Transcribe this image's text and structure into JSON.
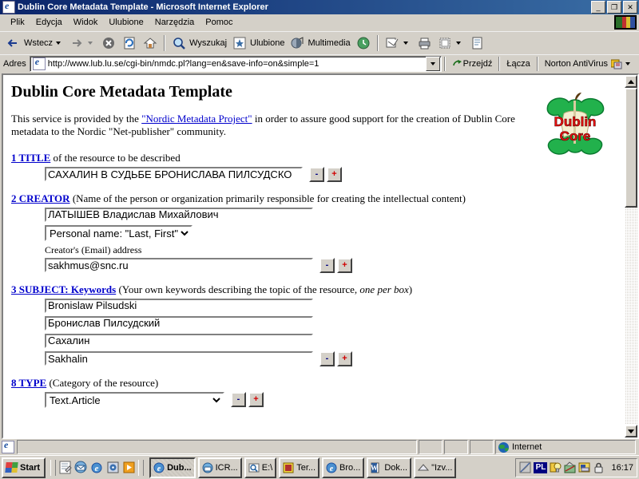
{
  "window": {
    "title": "Dublin Core Metadata Template - Microsoft Internet Explorer",
    "minimize": "_",
    "restore": "❐",
    "close": "✕"
  },
  "menu": [
    "Plik",
    "Edycja",
    "Widok",
    "Ulubione",
    "Narzędzia",
    "Pomoc"
  ],
  "toolbar": {
    "back": "Wstecz",
    "search": "Wyszukaj",
    "favorites": "Ulubione",
    "media": "Multimedia"
  },
  "address": {
    "label": "Adres",
    "url": "http://www.lub.lu.se/cgi-bin/nmdc.pl?lang=en&save-info=on&simple=1",
    "go": "Przejdź",
    "links": "Łącza",
    "antivirus": "Norton AntiVirus"
  },
  "page": {
    "title": "Dublin Core Metadata Template",
    "intro_before": "This service is provided by the ",
    "intro_link": "\"Nordic Metadata Project\"",
    "intro_after": " in order to assure good support for the creation of Dublin Core metadata to the Nordic \"Net-publisher\" community.",
    "logo_line1": "Dublin",
    "logo_line2": "Core",
    "minus": "-",
    "plus": "+",
    "sections": [
      {
        "number_label": "1 TITLE",
        "description": " of the resource to be described",
        "values": [
          "САХАЛИН В СУДЬБЕ БРОНИСЛАВА ПИЛСУДСКО"
        ]
      },
      {
        "number_label": "2 CREATOR",
        "description": " (Name of the person or organization primarily responsible for creating the intellectual content)",
        "values": [
          "ЛАТЫШЕВ Владислав Михайлович"
        ],
        "select_value": "Personal name: \"Last, First\"",
        "sublabel": "Creator's (Email) address",
        "email": "sakhmus@snc.ru"
      },
      {
        "number_label": "3 SUBJECT: Keywords",
        "description_plain": " (Your own keywords describing the topic of the resource, ",
        "description_italic": "one per box",
        "description_tail": ")",
        "values": [
          "Bronislaw Pilsudski",
          "Бронислав Пилсудский",
          "Сахалин",
          "Sakhalin"
        ]
      },
      {
        "number_label": "8 TYPE",
        "description": " (Category of the resource)",
        "select_value": "Text.Article"
      }
    ]
  },
  "status": {
    "message": "",
    "zone": "Internet"
  },
  "taskbar": {
    "start": "Start",
    "tasks": [
      {
        "label": "Dub...",
        "active": true
      },
      {
        "label": "ICR...",
        "active": false
      },
      {
        "label": "E:\\",
        "active": false
      },
      {
        "label": "Ter...",
        "active": false
      },
      {
        "label": "Bro...",
        "active": false
      },
      {
        "label": "Dok...",
        "active": false
      },
      {
        "label": "\"Izv...",
        "active": false
      }
    ],
    "language": "PL",
    "clock": "16:17"
  }
}
